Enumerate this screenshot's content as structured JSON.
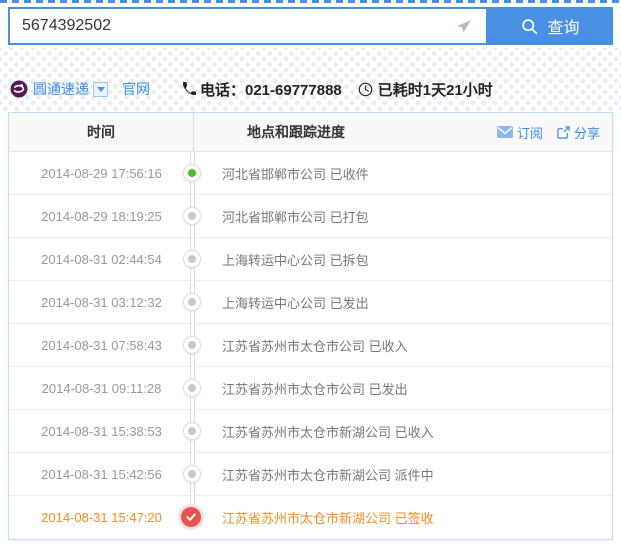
{
  "search": {
    "value": "5674392502",
    "button_label": "查询"
  },
  "carrier": {
    "name": "圆通速递",
    "official_site_label": "官网",
    "phone_label": "电话：021-69777888",
    "elapsed_label": "已耗时1天21小时"
  },
  "table": {
    "col_time": "时间",
    "col_progress": "地点和跟踪进度",
    "subscribe_label": "订阅",
    "share_label": "分享",
    "rows": [
      {
        "time": "2014-08-29 17:56:16",
        "text": "河北省邯郸市公司 已收件",
        "dot": "green"
      },
      {
        "time": "2014-08-29 18:19:25",
        "text": "河北省邯郸市公司 已打包",
        "dot": "gray"
      },
      {
        "time": "2014-08-31 02:44:54",
        "text": "上海转运中心公司 已拆包",
        "dot": "gray"
      },
      {
        "time": "2014-08-31 03:12:32",
        "text": "上海转运中心公司 已发出",
        "dot": "gray"
      },
      {
        "time": "2014-08-31 07:58:43",
        "text": "江苏省苏州市太仓市公司 已收入",
        "dot": "gray"
      },
      {
        "time": "2014-08-31 09:11:28",
        "text": "江苏省苏州市太仓市公司 已发出",
        "dot": "gray"
      },
      {
        "time": "2014-08-31 15:38:53",
        "text": "江苏省苏州市太仓市新湖公司 已收入",
        "dot": "gray"
      },
      {
        "time": "2014-08-31 15:42:56",
        "text": "江苏省苏州市太仓市新湖公司 派件中",
        "dot": "gray"
      },
      {
        "time": "2014-08-31 15:47:20",
        "text": "江苏省苏州市太仓市新湖公司 已签收",
        "dot": "signed"
      }
    ]
  },
  "icons": {
    "search": "magnifier-icon",
    "send": "paper-plane-icon",
    "dropdown": "chevron-down-icon",
    "phone": "phone-icon",
    "clock": "clock-icon",
    "subscribe": "envelope-icon",
    "share": "share-icon",
    "signed": "check-icon"
  },
  "colors": {
    "accent_blue": "#4a90e2",
    "link_blue": "#3d8de5",
    "signed_orange": "#fb8b20",
    "signed_red": "#e8534f",
    "received_green": "#4fbd21",
    "dot_gray": "#c9c9c9",
    "table_border_blue": "#c5dcf0"
  }
}
